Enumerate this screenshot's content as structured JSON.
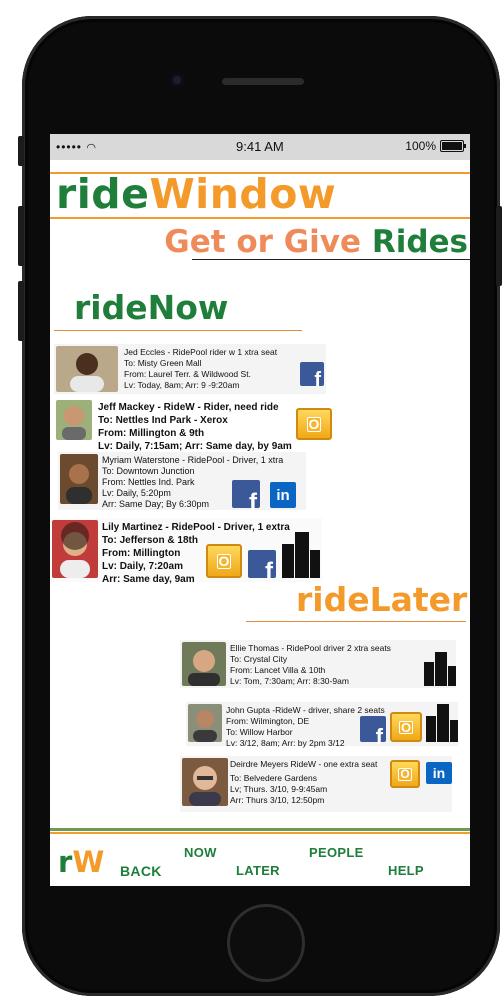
{
  "status": {
    "carrier": "•••••",
    "time": "9:41 AM",
    "battery": "100%"
  },
  "brand": {
    "ride": "ride",
    "window": "Window",
    "get_or_give": "Get or Give",
    "rides": "Rides"
  },
  "sections": {
    "now": "rideNow",
    "later": "rideLater"
  },
  "ride_now": [
    {
      "name": "Jed Eccles",
      "line1": "Jed Eccles - RidePool rider w 1 xtra seat",
      "line2": "To: Misty Green Mall",
      "line3": "From: Laurel Terr. & Wildwood St.",
      "line4": "Lv: Today, 8am; Arr: 9 -9:20am",
      "line5": "",
      "icons": [
        "facebook-icon"
      ]
    },
    {
      "name": "Jeff Mackey",
      "line1": "Jeff Mackey - RideW - Rider, need ride",
      "line2": "To:  Nettles Ind Park - Xerox",
      "line3": "From: Millington & 9th",
      "line4": "Lv: Daily, 7:15am; Arr: Same day, by 9am",
      "line5": "",
      "icons": [
        "outlook-icon"
      ]
    },
    {
      "name": "Myriam Waterstone",
      "line1": "Myriam Waterstone - RidePool - Driver, 1 xtra",
      "line2": "To: Downtown Junction",
      "line3": "From: Nettles Ind. Park",
      "line4": "Lv:  Daily, 5:20pm",
      "line5": "Arr: Same Day; By 6:30pm",
      "icons": [
        "facebook-icon",
        "linkedin-icon"
      ]
    },
    {
      "name": "Lily Martinez",
      "line1": "Lily Martinez - RidePool - Driver, 1 extra",
      "line2": "To: Jefferson & 18th",
      "line3": "From: Millington",
      "line4": "Lv: Daily, 7:20am",
      "line5": "Arr: Same day, 9am",
      "icons": [
        "outlook-icon",
        "facebook-icon",
        "building-icon"
      ]
    }
  ],
  "ride_later": [
    {
      "name": "Ellie Thomas",
      "line1": "Ellie Thomas - RidePool driver 2 xtra seats",
      "line2": "To: Crystal City",
      "line3": "From: Lancet Villa & 10th",
      "line4": "Lv: Tom, 7:30am; Arr: 8:30-9am",
      "icons": [
        "building-icon"
      ]
    },
    {
      "name": "John Gupta",
      "line1": "John Gupta -RideW - driver, share 2 seats",
      "line2": "From: Wilmington, DE",
      "line3": "To: Willow Harbor",
      "line4": "Lv: 3/12, 8am; Arr: by 2pm 3/12",
      "icons": [
        "facebook-icon",
        "outlook-icon",
        "building-icon"
      ]
    },
    {
      "name": "Deirdre Meyers",
      "line1": "Deirdre Meyers   RideW - one extra seat",
      "line2": "To: Belvedere Gardens",
      "line3": "Lv; Thurs. 3/10, 9-9:45am",
      "line4": "Arr: Thurs 3/10, 12:50pm",
      "icons": [
        "outlook-icon",
        "linkedin-icon"
      ]
    }
  ],
  "nav": {
    "logo_r": "r",
    "logo_w": "W",
    "back": "BACK",
    "now": "NOW",
    "later": "LATER",
    "people": "PEOPLE",
    "help": "HELP"
  },
  "colors": {
    "green": "#1e7e3a",
    "orange": "#f39a2a",
    "salmon": "#ef8b5a"
  }
}
